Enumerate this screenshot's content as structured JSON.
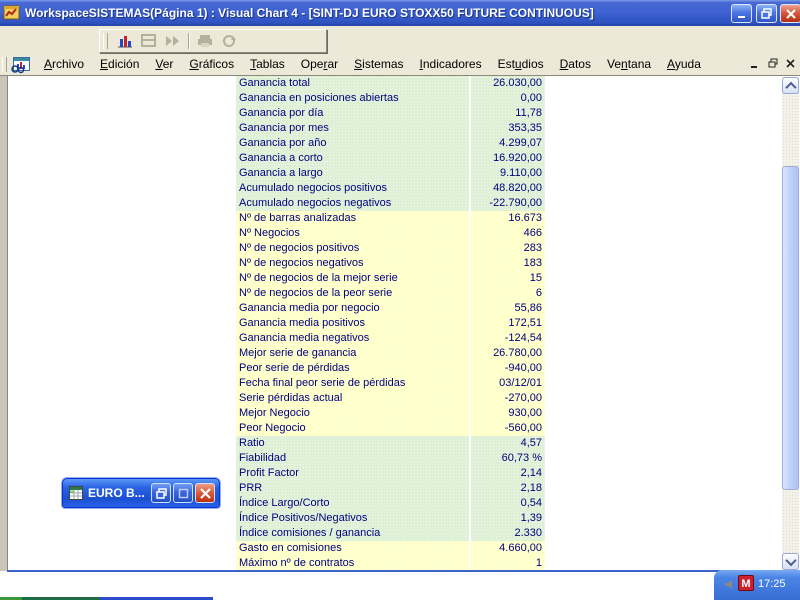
{
  "window": {
    "title": "WorkspaceSISTEMAS(Página 1) : Visual Chart 4 - [SINT-DJ EURO STOXX50 FUTURE CONTINUOUS]"
  },
  "menu": {
    "items": [
      {
        "label": "Archivo",
        "u": 0
      },
      {
        "label": "Edición",
        "u": 0
      },
      {
        "label": "Ver",
        "u": 0
      },
      {
        "label": "Gráficos",
        "u": 0
      },
      {
        "label": "Tablas",
        "u": 0
      },
      {
        "label": "Operar",
        "u": 3
      },
      {
        "label": "Sistemas",
        "u": 0
      },
      {
        "label": "Indicadores",
        "u": 0
      },
      {
        "label": "Estudios",
        "u": 3
      },
      {
        "label": "Datos",
        "u": 0
      },
      {
        "label": "Ventana",
        "u": 2
      },
      {
        "label": "Ayuda",
        "u": 0
      }
    ]
  },
  "stats_table": {
    "rows": [
      {
        "label": "Ganancia total",
        "value": "26.030,00",
        "tone": "green"
      },
      {
        "label": "Ganancia en posiciones abiertas",
        "value": "0,00",
        "tone": "green"
      },
      {
        "label": "Ganancia por día",
        "value": "11,78",
        "tone": "green"
      },
      {
        "label": "Ganancia por mes",
        "value": "353,35",
        "tone": "green"
      },
      {
        "label": "Ganancia por año",
        "value": "4.299,07",
        "tone": "green"
      },
      {
        "label": "Ganancia a corto",
        "value": "16.920,00",
        "tone": "green"
      },
      {
        "label": "Ganancia a largo",
        "value": "9.110,00",
        "tone": "green"
      },
      {
        "label": "Acumulado negocios positivos",
        "value": "48.820,00",
        "tone": "green"
      },
      {
        "label": "Acumulado negocios negativos",
        "value": "-22.790,00",
        "tone": "green"
      },
      {
        "label": "Nº de barras analizadas",
        "value": "16.673",
        "tone": "yellow"
      },
      {
        "label": "Nº Negocios",
        "value": "466",
        "tone": "yellow"
      },
      {
        "label": "Nº de negocios positivos",
        "value": "283",
        "tone": "yellow"
      },
      {
        "label": "Nº de negocios negativos",
        "value": "183",
        "tone": "yellow"
      },
      {
        "label": "Nº de negocios de la mejor serie",
        "value": "15",
        "tone": "yellow"
      },
      {
        "label": "Nº de negocios de la peor serie",
        "value": "6",
        "tone": "yellow"
      },
      {
        "label": "Ganancia media por negocio",
        "value": "55,86",
        "tone": "yellow"
      },
      {
        "label": "Ganancia media positivos",
        "value": "172,51",
        "tone": "yellow"
      },
      {
        "label": "Ganancia media negativos",
        "value": "-124,54",
        "tone": "yellow"
      },
      {
        "label": "Mejor serie de ganancia",
        "value": "26.780,00",
        "tone": "yellow"
      },
      {
        "label": "Peor serie de pérdidas",
        "value": "-940,00",
        "tone": "yellow"
      },
      {
        "label": "Fecha final peor serie de pérdidas",
        "value": "03/12/01",
        "tone": "yellow"
      },
      {
        "label": "Serie pérdidas actual",
        "value": "-270,00",
        "tone": "yellow"
      },
      {
        "label": "Mejor Negocio",
        "value": "930,00",
        "tone": "yellow"
      },
      {
        "label": "Peor Negocio",
        "value": "-560,00",
        "tone": "yellow"
      },
      {
        "label": "Ratio",
        "value": "4,57",
        "tone": "green"
      },
      {
        "label": "Fiabilidad",
        "value": "60,73 %",
        "tone": "green"
      },
      {
        "label": "Profit Factor",
        "value": "2,14",
        "tone": "green"
      },
      {
        "label": "PRR",
        "value": "2,18",
        "tone": "green"
      },
      {
        "label": "Índice Largo/Corto",
        "value": "0,54",
        "tone": "green"
      },
      {
        "label": "Índice Positivos/Negativos",
        "value": "1,39",
        "tone": "green"
      },
      {
        "label": "Índice comisiones / ganancia",
        "value": "2.330",
        "tone": "green"
      },
      {
        "label": "Gasto en comisiones",
        "value": "4.660,00",
        "tone": "yellow"
      },
      {
        "label": "Máximo nº de contratos",
        "value": "1",
        "tone": "yellow"
      }
    ]
  },
  "minimized_window": {
    "title": "EURO B..."
  },
  "tray": {
    "time": "17:25",
    "m_icon_label": "M"
  },
  "icons": {
    "app-icon": "chart-document",
    "minimize-icon": "_",
    "restore-icon": "❐",
    "close-icon": "✕",
    "scroll-up-icon": "∧",
    "scroll-down-icon": "∨",
    "chart-toolbar-icon": "bar-chart"
  },
  "colors": {
    "titlebar_blue": "#3f63d2",
    "chrome_beige": "#ece9d8",
    "row_green": "#def1d7",
    "row_yellow": "#ffffc9",
    "stat_text_navy": "#000080",
    "taskbar_blue": "#4a85e6",
    "close_red": "#d55b40"
  }
}
